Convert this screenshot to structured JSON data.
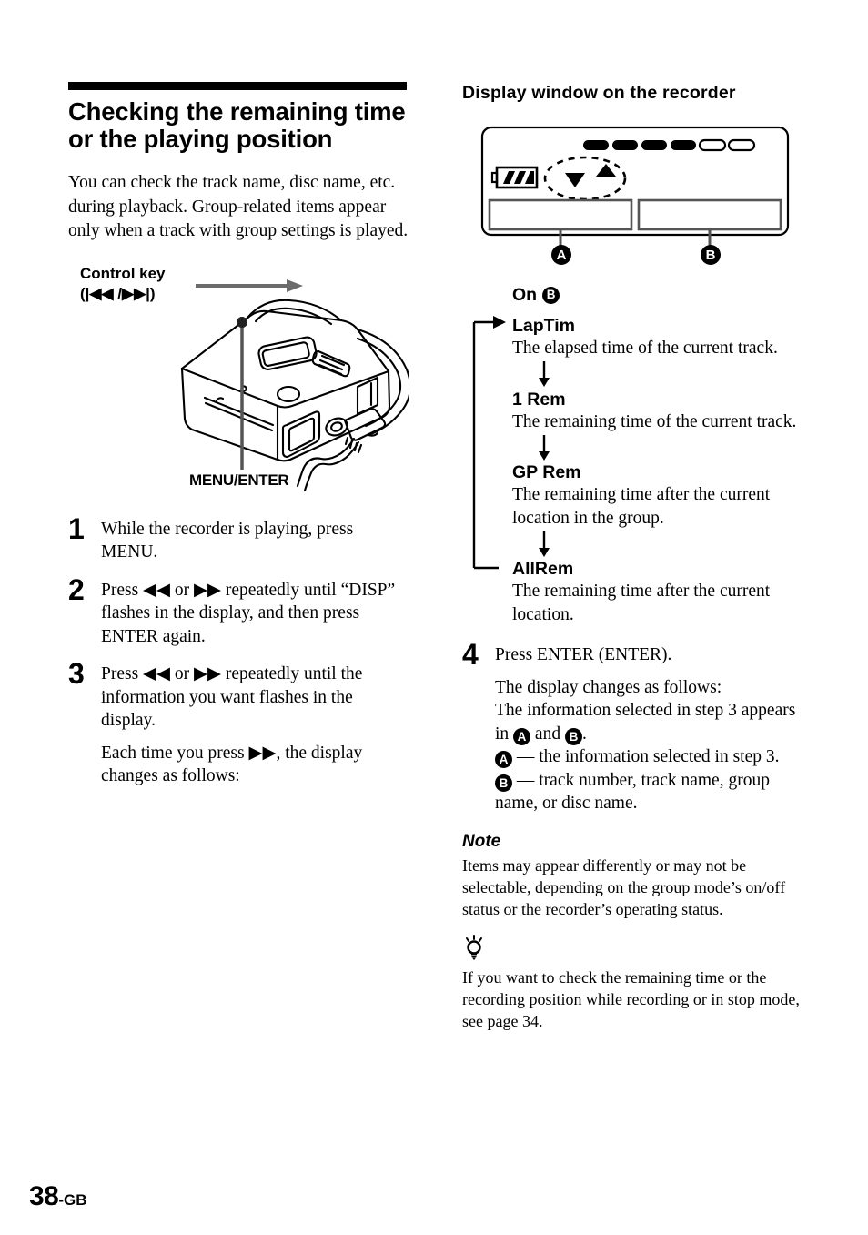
{
  "page": {
    "number": "38",
    "suffix": "-GB"
  },
  "left": {
    "section_title": "Checking the remaining time or the playing position",
    "intro": "You can check the track name, disc name, etc. during playback. Group-related items appear only when a track with group settings is played.",
    "figure": {
      "control_key_label_line1": "Control key",
      "control_key_label_line2": "(|◀◀ /▶▶|)",
      "menu_enter_label": "MENU/ENTER"
    },
    "steps": [
      {
        "number": "1",
        "paragraphs": [
          "While the recorder is playing, press MENU."
        ]
      },
      {
        "number": "2",
        "paragraphs": [
          "Press ◀◀ or ▶▶ repeatedly until “DISP” flashes in the display, and then press ENTER again."
        ]
      },
      {
        "number": "3",
        "paragraphs": [
          "Press ◀◀ or ▶▶ repeatedly until the information you want flashes in the display.",
          "Each time you press ▶▶, the display changes as follows:"
        ]
      }
    ]
  },
  "right": {
    "sub_title": "Display window on the recorder",
    "display_window": {
      "marker_a": "A",
      "marker_b": "B",
      "filled_segments": 4,
      "empty_segments": 2,
      "battery_bars": 3
    },
    "flow": {
      "heading_prefix": "On",
      "heading_badge": "B",
      "items": [
        {
          "name": "LapTim",
          "desc": "The elapsed time of the current track."
        },
        {
          "name": "1 Rem",
          "desc": "The remaining time of the current track."
        },
        {
          "name": "GP Rem",
          "desc": "The remaining time after the current location in the group."
        },
        {
          "name": "AllRem",
          "desc": "The remaining time after the current location."
        }
      ]
    },
    "step4": {
      "number": "4",
      "line1": "Press ENTER (ENTER).",
      "line2": "The display changes as follows:",
      "line3_a": "The information selected in step 3 appears in",
      "line3_mid": "and",
      "line3_end": ".",
      "bullet_a_badge": "A",
      "bullet_a_text": "— the information selected in step 3.",
      "bullet_b_badge": "B",
      "bullet_b_text": "— track number, track name, group name, or disc name."
    },
    "note": {
      "title": "Note",
      "body": "Items may appear differently or may not be selectable, depending on the group mode’s on/off status or the recorder’s operating status."
    },
    "tip": {
      "body": "If you want to check the remaining time or the recording position while recording or in stop mode, see page 34."
    }
  }
}
